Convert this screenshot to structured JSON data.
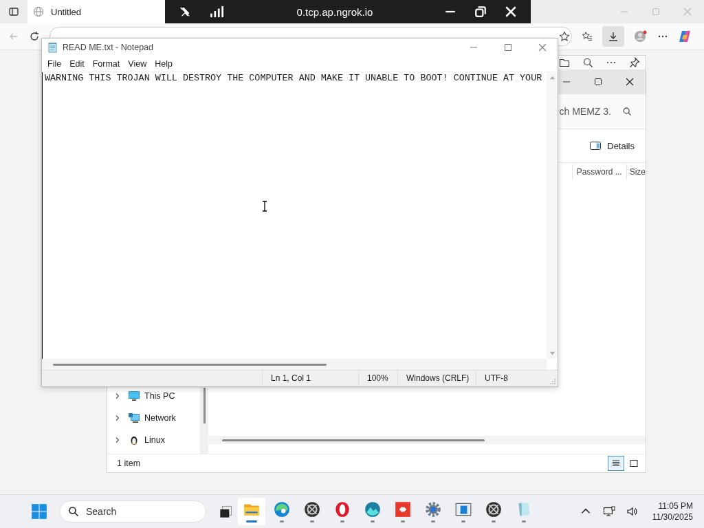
{
  "browser": {
    "tab": {
      "title": "Untitled"
    },
    "remote_bar": {
      "title": "0.tcp.ap.ngrok.io"
    },
    "download_active": true
  },
  "explorer": {
    "search": {
      "placeholder": "ch MEMZ 3."
    },
    "view_button": "Details",
    "columns": [
      "Password ...",
      "Size"
    ],
    "nav_items": [
      {
        "label": "This PC",
        "kind": "pc"
      },
      {
        "label": "Network",
        "kind": "network"
      },
      {
        "label": "Linux",
        "kind": "linux"
      }
    ],
    "status": "1 item",
    "views": [
      {
        "kind": "details",
        "selected": true
      },
      {
        "kind": "tiles",
        "selected": false
      }
    ]
  },
  "notepad": {
    "title": "READ ME.txt - Notepad",
    "menu": [
      "File",
      "Edit",
      "Format",
      "View",
      "Help"
    ],
    "text": "WARNING THIS TROJAN WILL DESTROY THE COMPUTER AND MAKE IT UNABLE TO BOOT! CONTINUE AT YOUR",
    "status": [
      "Ln 1, Col 1",
      "100%",
      "Windows (CRLF)",
      "UTF-8"
    ]
  },
  "taskbar": {
    "search": {
      "placeholder": "Search"
    },
    "apps": [
      {
        "kind": "folder",
        "selected": true
      },
      {
        "kind": "browser",
        "selected": false
      },
      {
        "kind": "aperture",
        "selected": false
      },
      {
        "kind": "opera",
        "selected": false
      },
      {
        "kind": "wave",
        "selected": false
      },
      {
        "kind": "arrows",
        "selected": false
      },
      {
        "kind": "gear",
        "selected": false
      },
      {
        "kind": "window",
        "selected": false
      },
      {
        "kind": "aperture",
        "selected": false
      },
      {
        "kind": "notepad",
        "selected": false
      }
    ],
    "time": "11:05 PM",
    "date": "11/30/2025"
  }
}
